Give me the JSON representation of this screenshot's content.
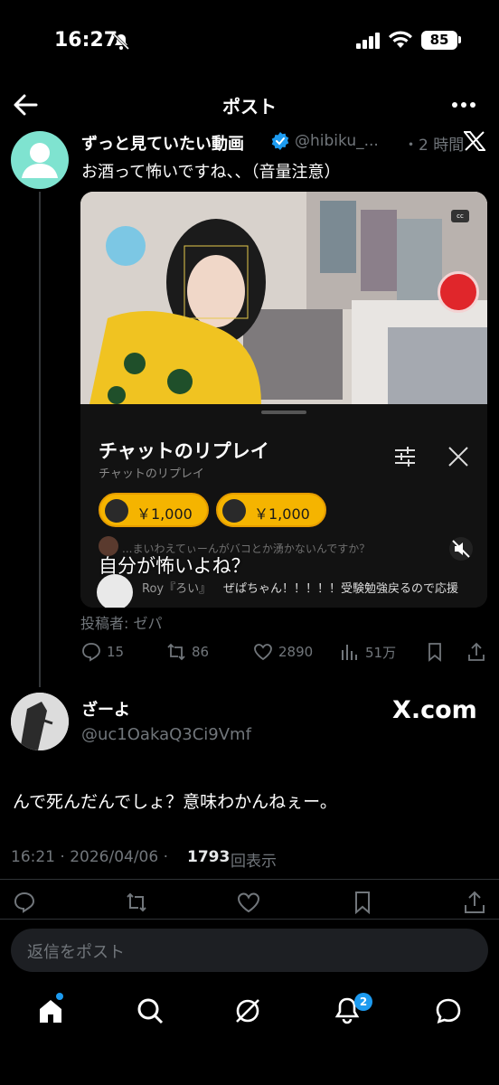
{
  "status_bar": {
    "time": "16:27",
    "battery": "85"
  },
  "header": {
    "title": "ポスト"
  },
  "quoted_post": {
    "author": "ずっと見ていたい動画",
    "handle": "@hibiku_...",
    "time": "・2 時間",
    "text": "お酒って怖いですね、、（音量注意）",
    "media": {
      "chat_title": "チャットのリプレイ",
      "chat_subtitle": "チャットのリプレイ",
      "superchats": [
        {
          "amount": "￥1,000"
        },
        {
          "amount": "￥1,000"
        }
      ],
      "faded_message": "...まいわえてぃーんがバコとか湧かないんですか？",
      "caption": "自分が怖いよね？",
      "chat_name": "Roy『ろい』",
      "chat_message": "ぜぱちゃん！！！！！受験勉強戻るので応援"
    },
    "contributor": "投稿者: ゼパ",
    "actions": {
      "replies": "15",
      "reposts": "86",
      "likes": "2890",
      "views": "51万"
    }
  },
  "reply": {
    "author": "ざーよ",
    "handle": "@uc1OakaQ3Ci9Vmf",
    "brand": "X.com",
    "text": "んで死んだんでしょ？意味わかんねぇー。",
    "timestamp": "16:21 · 2026/04/06 ·",
    "views": "1793",
    "views_label": "回表示"
  },
  "composer": {
    "placeholder": "返信をポスト"
  },
  "tabbar": {
    "notifications_badge": "2"
  },
  "colors": {
    "accent": "#1d9bf0",
    "superchat": "#f5b400",
    "record": "#e0262b"
  }
}
